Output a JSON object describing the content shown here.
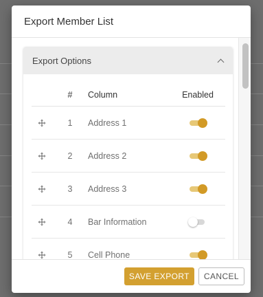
{
  "dialog": {
    "title": "Export Member List"
  },
  "panel": {
    "title": "Export Options",
    "expanded": true
  },
  "table": {
    "headers": {
      "number": "#",
      "column": "Column",
      "enabled": "Enabled"
    },
    "rows": [
      {
        "number": "1",
        "column": "Address 1",
        "enabled": true
      },
      {
        "number": "2",
        "column": "Address 2",
        "enabled": true
      },
      {
        "number": "3",
        "column": "Address 3",
        "enabled": true
      },
      {
        "number": "4",
        "column": "Bar Information",
        "enabled": false
      },
      {
        "number": "5",
        "column": "Cell Phone",
        "enabled": true
      }
    ]
  },
  "footer": {
    "save_label": "SAVE EXPORT",
    "cancel_label": "CANCEL"
  },
  "colors": {
    "accent": "#d3a030",
    "toggle_track_on": "#e7c877"
  }
}
